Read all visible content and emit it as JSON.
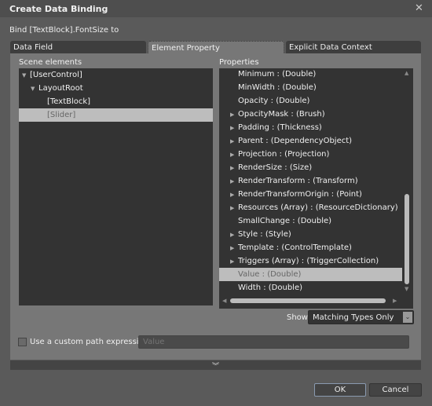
{
  "window": {
    "title": "Create Data Binding",
    "close_icon": "close-icon"
  },
  "bind_label": "Bind [TextBlock].FontSize to",
  "tabs": [
    {
      "label": "Data Field"
    },
    {
      "label": "Element Property",
      "active": true
    },
    {
      "label": "Explicit Data Context"
    }
  ],
  "scene": {
    "label": "Scene elements",
    "items": [
      {
        "label": "[UserControl]",
        "expanded": true,
        "level": 0
      },
      {
        "label": "LayoutRoot",
        "expanded": true,
        "level": 1
      },
      {
        "label": "[TextBlock]",
        "level": 2
      },
      {
        "label": "[Slider]",
        "level": 2,
        "selected": true
      }
    ]
  },
  "properties": {
    "label": "Properties",
    "items": [
      {
        "label": "Minimum : (Double)",
        "expandable": false
      },
      {
        "label": "MinWidth : (Double)",
        "expandable": false
      },
      {
        "label": "Opacity : (Double)",
        "expandable": false
      },
      {
        "label": "OpacityMask : (Brush)",
        "expandable": true
      },
      {
        "label": "Padding : (Thickness)",
        "expandable": true
      },
      {
        "label": "Parent : (DependencyObject)",
        "expandable": true
      },
      {
        "label": "Projection : (Projection)",
        "expandable": true
      },
      {
        "label": "RenderSize : (Size)",
        "expandable": true
      },
      {
        "label": "RenderTransform : (Transform)",
        "expandable": true
      },
      {
        "label": "RenderTransformOrigin : (Point)",
        "expandable": true
      },
      {
        "label": "Resources (Array) : (ResourceDictionary)",
        "expandable": true
      },
      {
        "label": "SmallChange : (Double)",
        "expandable": false
      },
      {
        "label": "Style : (Style)",
        "expandable": true
      },
      {
        "label": "Template : (ControlTemplate)",
        "expandable": true
      },
      {
        "label": "Triggers (Array) : (TriggerCollection)",
        "expandable": true
      },
      {
        "label": "Value : (Double)",
        "expandable": false,
        "selected": true
      },
      {
        "label": "Width : (Double)",
        "expandable": false
      }
    ]
  },
  "show": {
    "label": "Show",
    "value": "Matching Types Only"
  },
  "custom_path": {
    "label": "Use a custom path expression",
    "checked": false,
    "placeholder": "Value"
  },
  "buttons": {
    "ok": "OK",
    "cancel": "Cancel"
  }
}
